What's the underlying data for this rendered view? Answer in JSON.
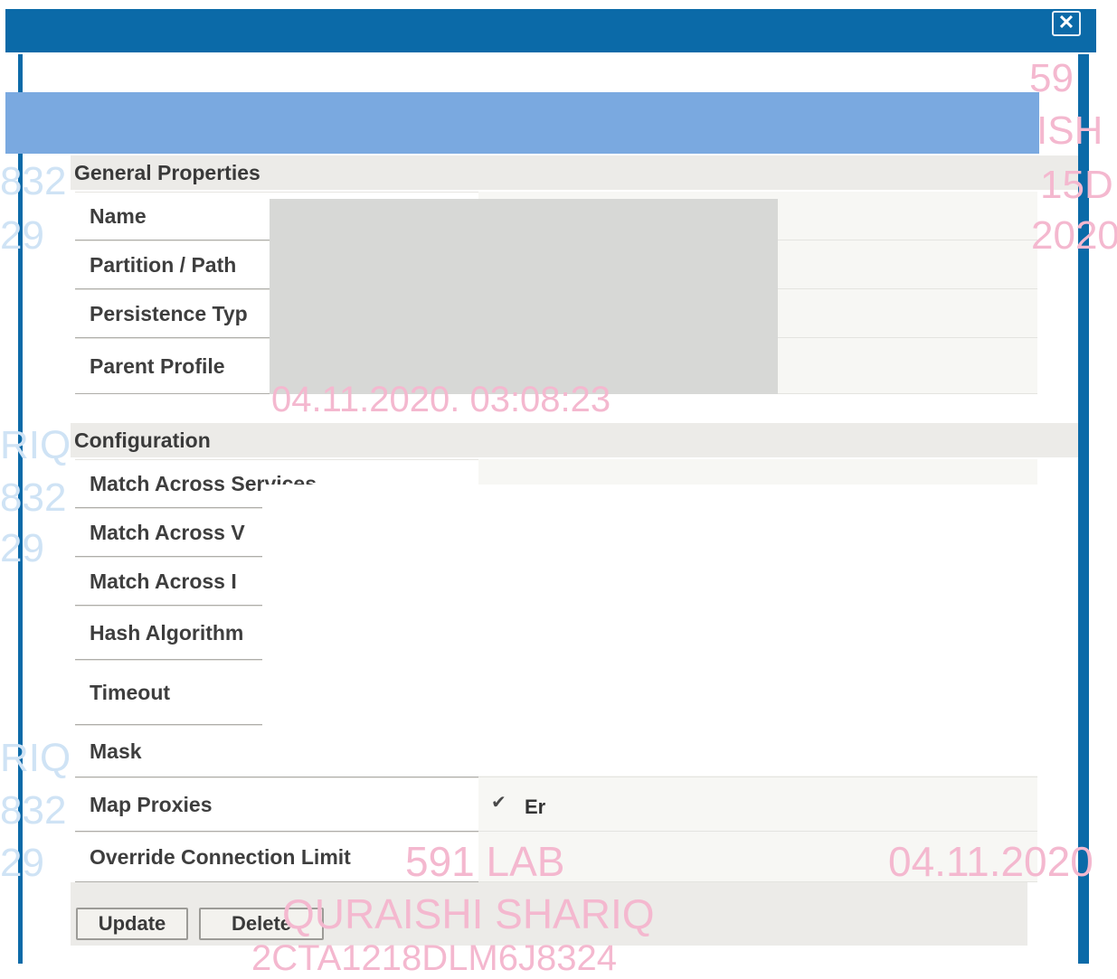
{
  "dialog": {
    "close_label": "✕"
  },
  "general_properties": {
    "title": "General Properties",
    "rows": [
      {
        "label": "Name"
      },
      {
        "label": "Partition / Path"
      },
      {
        "label": "Persistence Typ"
      },
      {
        "label": "Parent Profile"
      }
    ]
  },
  "configuration": {
    "title": "Configuration",
    "rows": [
      {
        "label": "Match Across Services"
      },
      {
        "label": "Match Across V"
      },
      {
        "label": "Match Across I"
      },
      {
        "label": "Hash Algorithm"
      },
      {
        "label": "Timeout"
      },
      {
        "label": "Mask"
      },
      {
        "label": "Map Proxies"
      },
      {
        "label": "Override Connection Limit"
      }
    ],
    "map_proxies_value": "Er"
  },
  "buttons": {
    "update": "Update",
    "delete": "Delete"
  },
  "watermark": {
    "lab": "591 LAB",
    "date": "04.11.2020",
    "name": "QURAISHI SHARIQ",
    "code": "2CTA1218DLM6J8324",
    "fragment_59": "59",
    "fragment_ish": "ISH",
    "fragment_15d": "15D",
    "fragment_2020": "2020",
    "fragment_832": "832",
    "fragment_29": "29",
    "fragment_riq": "RIQ",
    "fragment_time": "04.11.2020. 03:08:23"
  },
  "colors": {
    "titlebar": "#0b6aa8",
    "header_band": "#7aa9e0",
    "watermark": "#f4b8cf"
  }
}
